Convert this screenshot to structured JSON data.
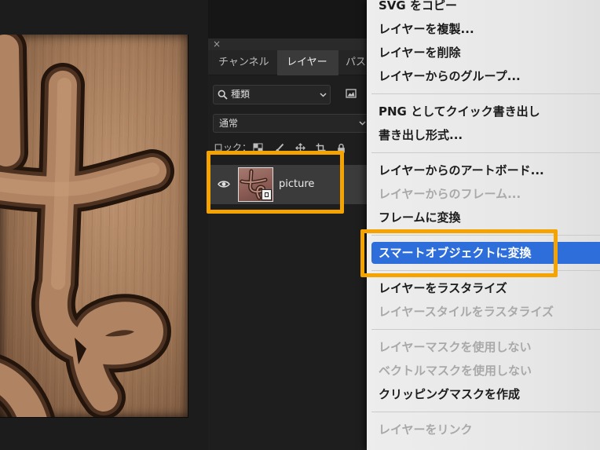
{
  "panel": {
    "close_label": "×",
    "tabs": [
      {
        "label": "チャンネル",
        "active": false
      },
      {
        "label": "レイヤー",
        "active": true
      },
      {
        "label": "パス",
        "active": false
      }
    ],
    "filter": {
      "value": "種類",
      "icon": "search-icon"
    },
    "blend_mode": {
      "value": "通常"
    },
    "lock": {
      "label": "ロック：",
      "icons": [
        "transparency-lock-icon",
        "brush-lock-icon",
        "move-lock-icon",
        "artboard-lock-icon",
        "lock-all-icon"
      ]
    },
    "layers": [
      {
        "name": "picture",
        "visible": true,
        "selected": true
      }
    ]
  },
  "context_menu": {
    "items": [
      {
        "label": "SVG をコピー"
      },
      {
        "label": "レイヤーを複製..."
      },
      {
        "label": "レイヤーを削除"
      },
      {
        "label": "レイヤーからのグループ..."
      },
      {
        "label": "PNG としてクイック書き出し"
      },
      {
        "label": "書き出し形式..."
      },
      {
        "label": "レイヤーからのアートボード..."
      },
      {
        "label": "レイヤーからのフレーム...",
        "disabled": true
      },
      {
        "label": "フレームに変換"
      },
      {
        "label": "スマートオブジェクトに変換",
        "highlighted": true
      },
      {
        "label": "レイヤーをラスタライズ"
      },
      {
        "label": "レイヤースタイルをラスタライズ",
        "disabled": true
      },
      {
        "label": "レイヤーマスクを使用しない",
        "disabled": true
      },
      {
        "label": "ベクトルマスクを使用しない",
        "disabled": true
      },
      {
        "label": "クリッピングマスクを作成"
      },
      {
        "label": "レイヤーをリンク",
        "disabled": true
      }
    ]
  },
  "colors": {
    "menu_highlight": "#2e6edb",
    "annotation_box": "#f5a300",
    "panel_background": "#1e1e1e",
    "menu_background": "#e8e8e8"
  }
}
